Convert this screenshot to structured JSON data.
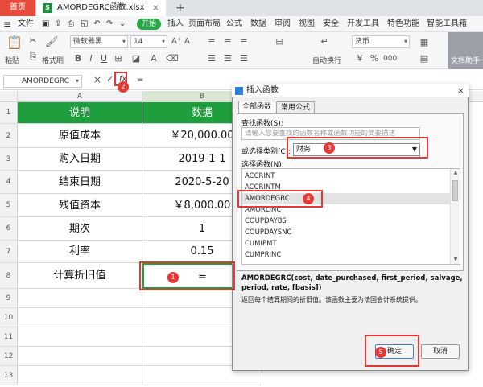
{
  "titlebar": {
    "home_tab": "首页",
    "file_name": "AMORDEGRC函数.xlsx",
    "file_icon": "S",
    "close_glyph": "×",
    "new_tab": "+"
  },
  "menu": {
    "file_label": "文件",
    "start_label": "开始",
    "items": [
      "插入",
      "页面布局",
      "公式",
      "数据",
      "审阅",
      "视图",
      "安全",
      "开发工具",
      "特色功能",
      "智能工具箱"
    ]
  },
  "ribbon": {
    "paste_label": "粘贴",
    "format_painter_label": "格式刷",
    "font_name": "微软雅黑",
    "font_size": "14",
    "wrap_label": "自动换行",
    "number_format": "货币",
    "helper_label": "文档助手"
  },
  "formula_bar": {
    "name_box": "AMORDEGRC",
    "cancel_glyph": "×",
    "confirm_glyph": "✓",
    "fx_label": "fx",
    "content": "="
  },
  "sheet": {
    "columns": [
      "A",
      "B"
    ],
    "rows": [
      {
        "num": "1",
        "a": "说明",
        "b": "数据"
      },
      {
        "num": "2",
        "a": "原值成本",
        "b": "￥20,000.00"
      },
      {
        "num": "3",
        "a": "购入日期",
        "b": "2019-1-1"
      },
      {
        "num": "4",
        "a": "结束日期",
        "b": "2020-5-20"
      },
      {
        "num": "5",
        "a": "残值资本",
        "b": "￥8,000.00"
      },
      {
        "num": "6",
        "a": "期次",
        "b": "1"
      },
      {
        "num": "7",
        "a": "利率",
        "b": "0.15"
      },
      {
        "num": "8",
        "a": "计算折旧值",
        "b": "="
      },
      {
        "num": "9",
        "a": "",
        "b": ""
      },
      {
        "num": "10",
        "a": "",
        "b": ""
      },
      {
        "num": "11",
        "a": "",
        "b": ""
      },
      {
        "num": "12",
        "a": "",
        "b": ""
      },
      {
        "num": "13",
        "a": "",
        "b": ""
      }
    ],
    "header_color": "#1e9e3c"
  },
  "dialog": {
    "title": "插入函数",
    "close_glyph": "×",
    "tabs": [
      "全部函数",
      "常用公式"
    ],
    "search_label": "查找函数(S):",
    "search_placeholder": "请输入您要查找的函数名称或函数功能的简要描述",
    "category_label": "或选择类别(C):",
    "category_value": "财务",
    "list_label": "选择函数(N):",
    "functions": [
      "ACCRINT",
      "ACCRINTM",
      "AMORDEGRC",
      "AMORLINC",
      "COUPDAYBS",
      "COUPDAYSNC",
      "CUMIPMT",
      "CUMPRINC"
    ],
    "selected_function": "AMORDEGRC",
    "signature": "AMORDEGRC(cost, date_purchased, first_period, salvage, period, rate, [basis])",
    "description": "返回每个结算期间的折旧值。该函数主要为法国会计系统提供。",
    "ok_label": "确定",
    "cancel_label": "取消"
  },
  "annotations": {
    "badges": [
      "1",
      "2",
      "3",
      "4",
      "5"
    ],
    "color": "#e53935"
  }
}
